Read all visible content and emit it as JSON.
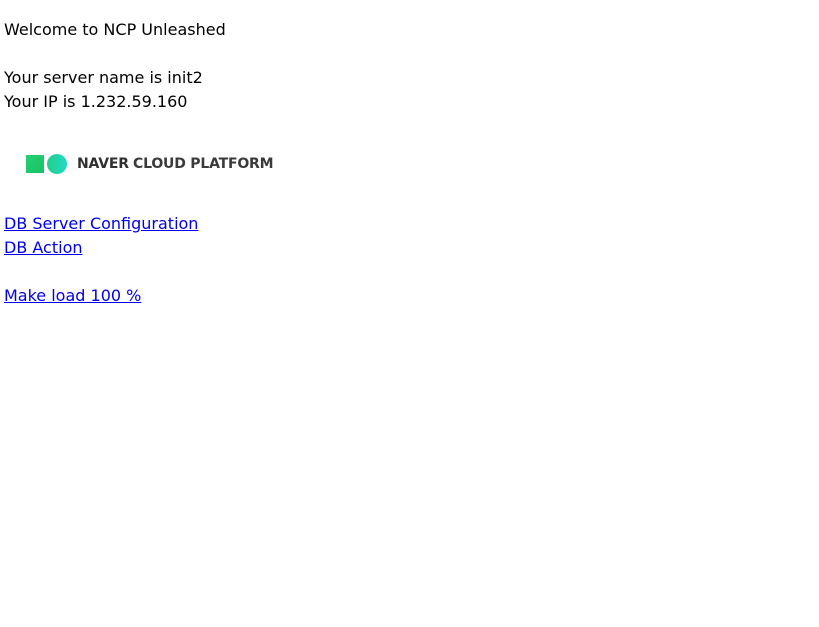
{
  "welcome": "Welcome to NCP Unleashed",
  "server_line": "Your server name is init2",
  "ip_line": "Your IP is 1.232.59.160",
  "logo": {
    "brand": "NAVER",
    "suffix": "CLOUD PLATFORM",
    "colors": {
      "square": "#24d06e",
      "circle_start": "#1fd089",
      "circle_end": "#26d7c9",
      "text": "#303030"
    }
  },
  "links": {
    "db_config": "DB Server Configuration",
    "db_action": "DB Action",
    "make_load": "Make load 100 %"
  },
  "colors": {
    "link": "#0000ee",
    "text": "#000000",
    "background": "#ffffff"
  }
}
